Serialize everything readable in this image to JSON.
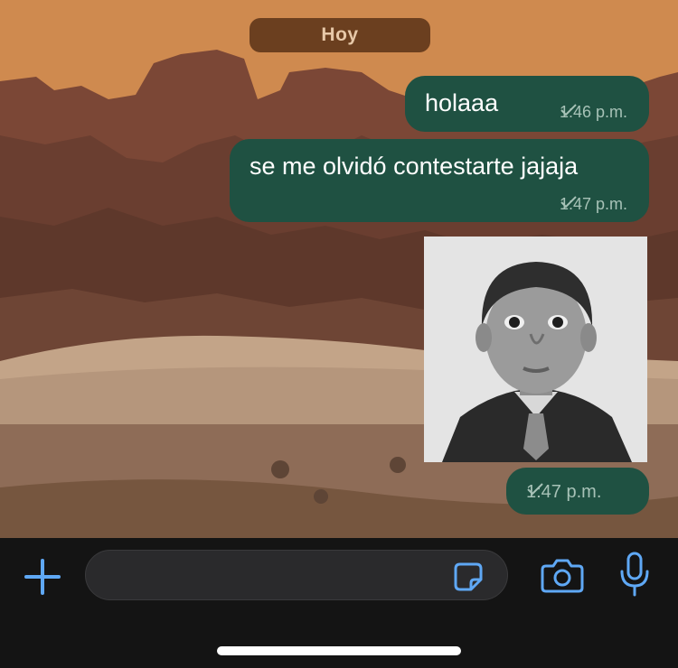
{
  "chat": {
    "date_label": "Hoy",
    "messages": [
      {
        "text": "holaaa",
        "time": "1:46 p.m.",
        "status": "sent-check"
      },
      {
        "text": "se me olvidó contestarte jajaja",
        "time": "1:47 p.m.",
        "status": "sent-check"
      },
      {
        "type": "photo",
        "time": "1:47 p.m.",
        "status": "sent-check"
      }
    ]
  },
  "input_bar": {
    "text_value": "",
    "icons": [
      "plus-icon",
      "sticker-icon",
      "camera-icon",
      "microphone-icon"
    ]
  },
  "colors": {
    "bubble": "#1f5142",
    "accent": "#5fa8f5",
    "date_pill": "#6b3f1f"
  }
}
